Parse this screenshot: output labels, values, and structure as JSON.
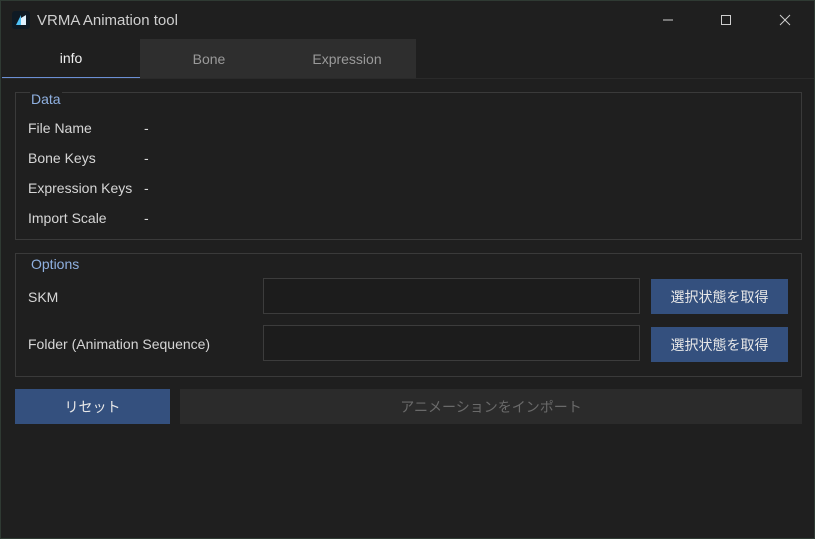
{
  "window": {
    "title": "VRMA Animation tool",
    "icon": "app-logo-icon",
    "controls": [
      "minimize-icon",
      "maximize-icon",
      "close-icon"
    ]
  },
  "tabs": [
    {
      "label": "info",
      "active": true
    },
    {
      "label": "Bone",
      "active": false
    },
    {
      "label": "Expression",
      "active": false
    }
  ],
  "data_group": {
    "title": "Data",
    "rows": [
      {
        "label": "File Name",
        "value": "-"
      },
      {
        "label": "Bone Keys",
        "value": "-"
      },
      {
        "label": "Expression Keys",
        "value": "-"
      },
      {
        "label": "Import Scale",
        "value": "-"
      }
    ]
  },
  "options_group": {
    "title": "Options",
    "rows": [
      {
        "label": "SKM",
        "value": "",
        "button": "選択状態を取得"
      },
      {
        "label": "Folder (Animation Sequence)",
        "value": "",
        "button": "選択状態を取得"
      }
    ]
  },
  "actions": {
    "reset_label": "リセット",
    "import_label": "アニメーションをインポート",
    "import_enabled": false
  },
  "colors": {
    "background": "#1f1f1f",
    "accent": "#34507e",
    "group_title": "#8fb0e0",
    "active_tab_underline": "#6b8fd4"
  }
}
